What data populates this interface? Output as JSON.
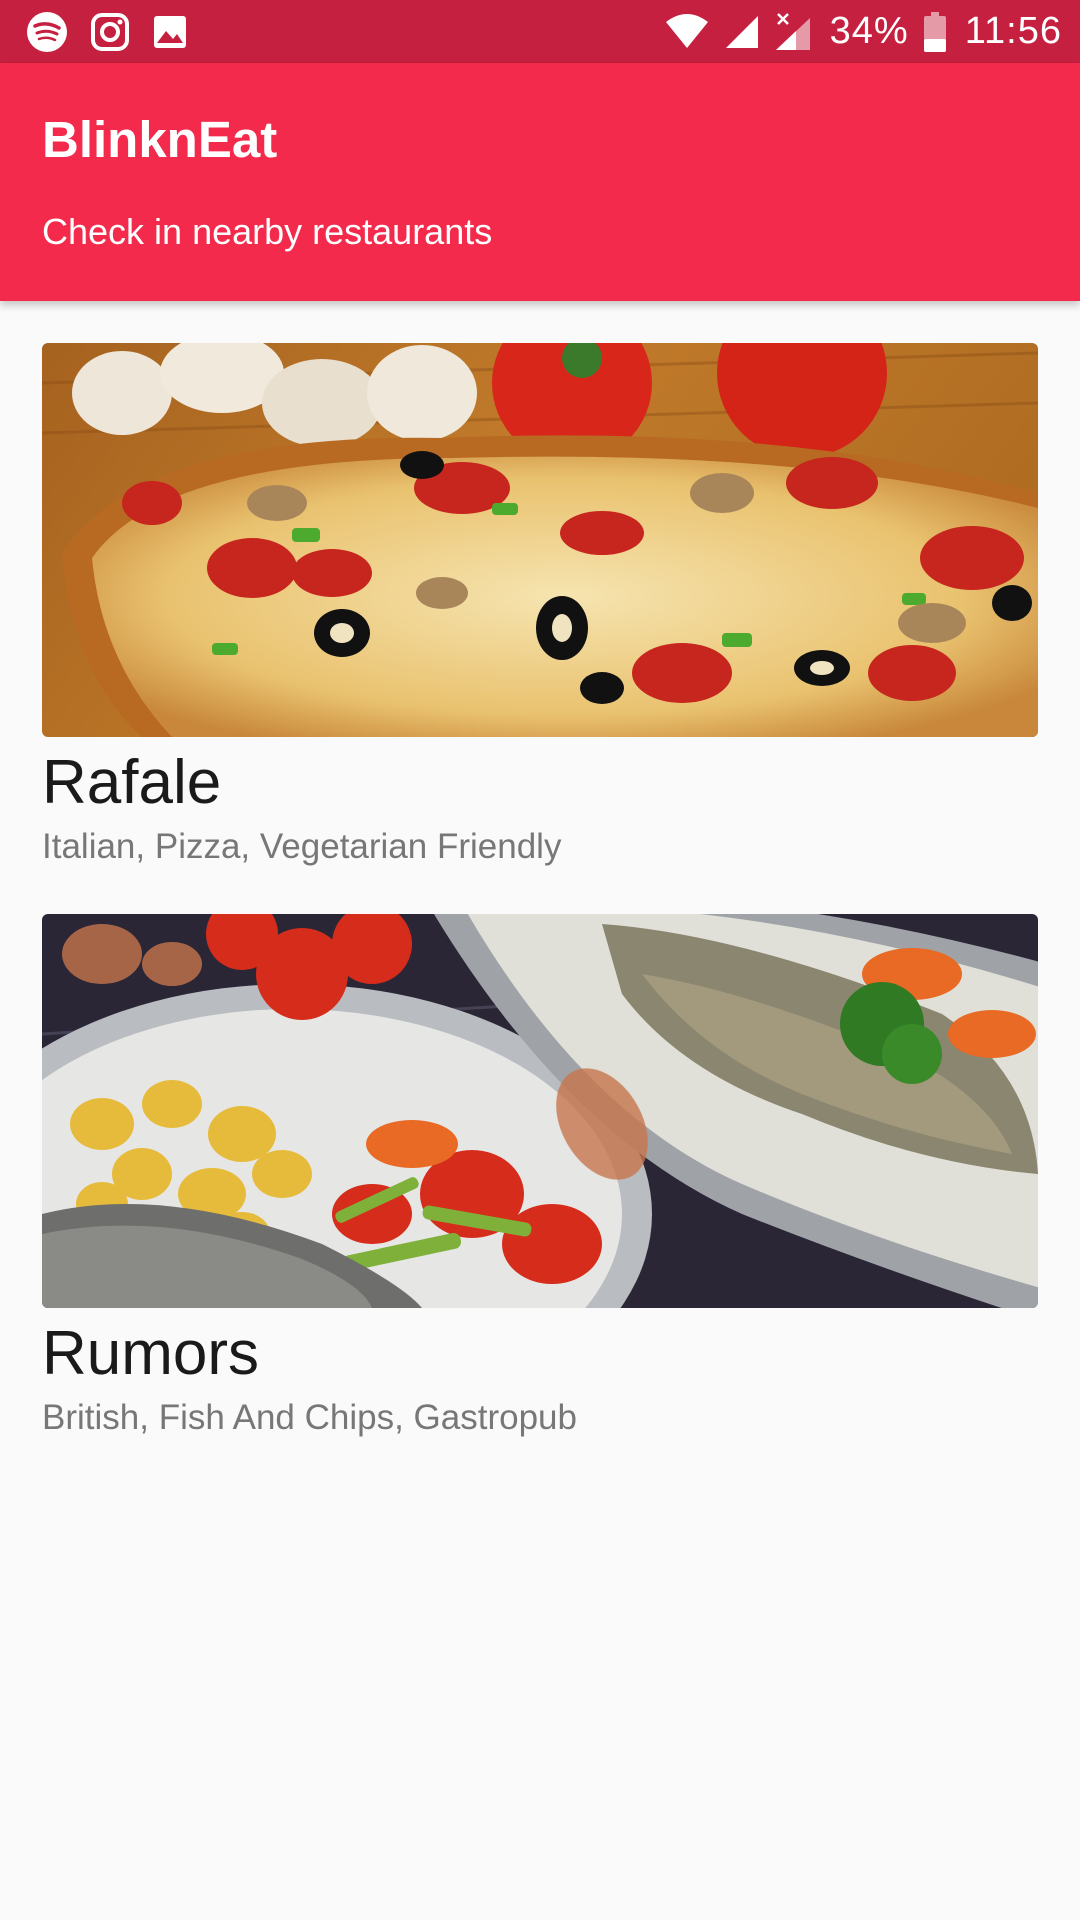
{
  "status_bar": {
    "left_icons": [
      "spotify-icon",
      "instagram-icon",
      "gallery-icon"
    ],
    "right_icons": [
      "wifi-icon",
      "cell-signal-icon",
      "cell-signal-no-data-icon",
      "battery-icon"
    ],
    "battery": "34%",
    "time": "11:56",
    "color": "#c5203f"
  },
  "app_bar": {
    "title": "BlinknEat",
    "subtitle": "Check in nearby restaurants",
    "color": "#f32a4b"
  },
  "restaurants": [
    {
      "name": "Rafale",
      "cuisines": "Italian, Pizza, Vegetarian Friendly",
      "image": "pizza-photo"
    },
    {
      "name": "Rumors",
      "cuisines": "British, Fish And Chips, Gastropub",
      "image": "fish-platter-photo"
    }
  ]
}
